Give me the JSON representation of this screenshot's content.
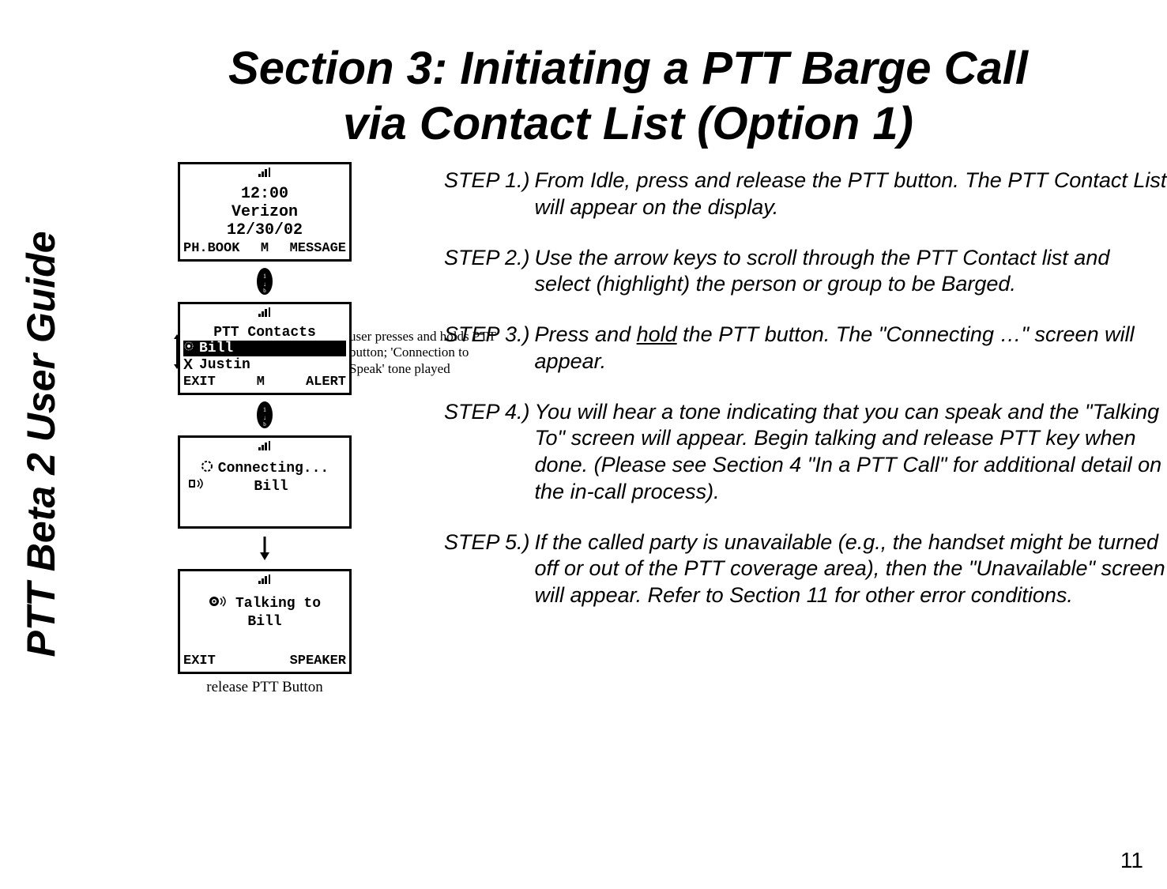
{
  "sidebar": {
    "label": "PTT Beta 2 User Guide"
  },
  "title": {
    "line1": "Section 3: Initiating a PTT Barge Call",
    "line2": "via Contact List (Option 1)"
  },
  "screens": {
    "idle": {
      "time": "12:00",
      "carrier": "Verizon",
      "date": "12/30/02",
      "soft_left": "PH.BOOK",
      "soft_mid": "M",
      "soft_right": "MESSAGE"
    },
    "contacts": {
      "header": "PTT Contacts",
      "item1": "Bill",
      "item2": "Justin",
      "soft_left": "EXIT",
      "soft_mid": "M",
      "soft_right": "ALERT"
    },
    "connecting": {
      "status": "Connecting...",
      "name": "Bill"
    },
    "talking": {
      "status": "Talking to",
      "name": "Bill",
      "soft_left": "EXIT",
      "soft_right": "SPEAKER"
    },
    "release_caption": "release PTT Button"
  },
  "side_note": "user presses and holds  PTT button; 'Connection to Speak' tone played",
  "steps": {
    "s1": {
      "label": "STEP 1.)",
      "text": "From Idle, press and release the PTT button.  The PTT Contact List will appear on the display."
    },
    "s2": {
      "label": "STEP 2.)",
      "text": "Use the arrow keys to scroll through the PTT Contact list and select (highlight) the person or group to be Barged."
    },
    "s3": {
      "label": "STEP 3.)",
      "pre": "Press and ",
      "u": "hold",
      "post": " the PTT button.  The \"Connecting …\" screen will appear."
    },
    "s4": {
      "label": "STEP 4.)",
      "text": "You will hear a tone indicating that you can speak and the \"Talking To\" screen will appear.   Begin talking and release PTT key when done.  (Please see Section 4 \"In a PTT Call\" for additional detail on the in-call process)."
    },
    "s5": {
      "label": "STEP 5.)",
      "text": "If the called party is unavailable (e.g., the handset might be turned off or out of the PTT coverage area), then the \"Unavailable\" screen will appear. Refer to Section 11 for other error conditions."
    }
  },
  "page_number": "11"
}
